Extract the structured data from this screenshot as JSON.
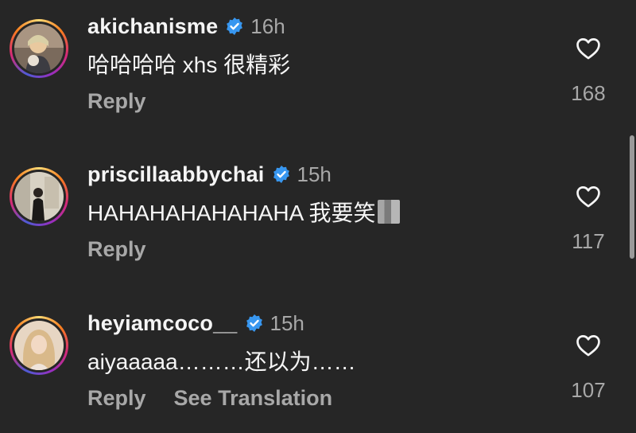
{
  "comments": [
    {
      "username": "akichanisme",
      "time": "16h",
      "text": "哈哈哈哈 xhs 很精彩",
      "reply_label": "Reply",
      "likes": "168",
      "verified": true
    },
    {
      "username": "priscillaabbychai",
      "time": "15h",
      "text": "HAHAHAHAHAHAHA 我要笑",
      "reply_label": "Reply",
      "likes": "117",
      "verified": true
    },
    {
      "username": "heyiamcoco__",
      "time": "15h",
      "text": "aiyaaaaa………还以为……",
      "reply_label": "Reply",
      "see_translation_label": "See Translation",
      "likes": "107",
      "verified": true
    }
  ],
  "colors": {
    "background": "#262626",
    "text_primary": "#f5f5f5",
    "text_secondary": "#a8a8a8",
    "verified_blue": "#3897f0"
  }
}
